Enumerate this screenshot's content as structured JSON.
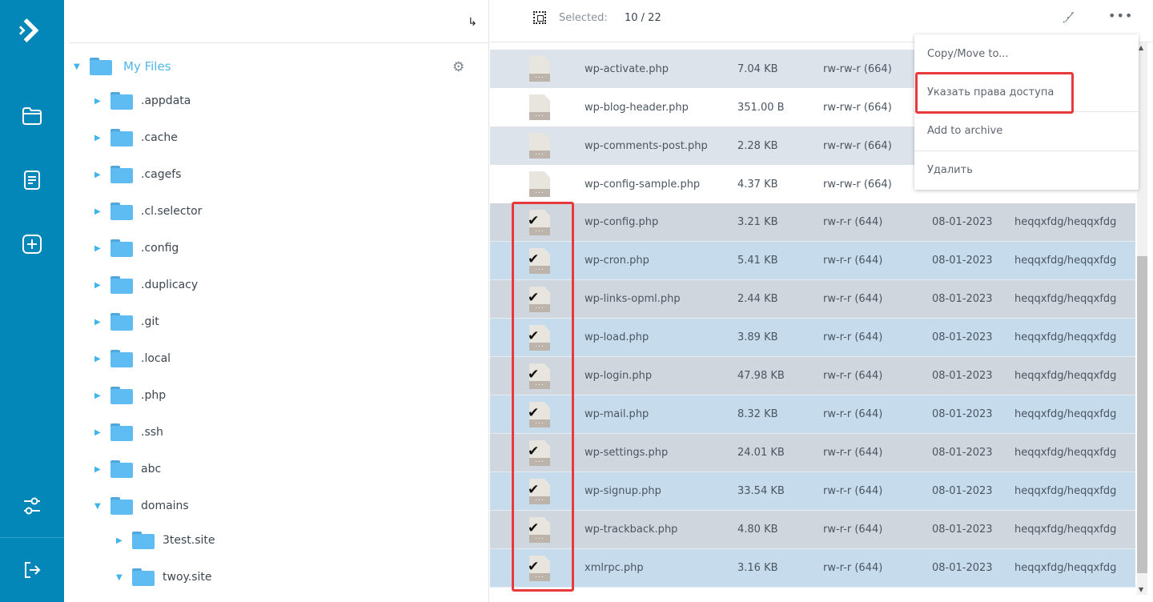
{
  "rail": {
    "icons": [
      "logo-icon",
      "folder-icon",
      "document-icon",
      "add-icon",
      "settings-sliders-icon",
      "logout-icon"
    ]
  },
  "tree": {
    "root": "My Files",
    "items": [
      {
        "label": ".appdata",
        "expanded": false
      },
      {
        "label": ".cache",
        "expanded": false
      },
      {
        "label": ".cagefs",
        "expanded": false
      },
      {
        "label": ".cl.selector",
        "expanded": false
      },
      {
        "label": ".config",
        "expanded": false
      },
      {
        "label": ".duplicacy",
        "expanded": false
      },
      {
        "label": ".git",
        "expanded": false
      },
      {
        "label": ".local",
        "expanded": false
      },
      {
        "label": ".php",
        "expanded": false
      },
      {
        "label": ".ssh",
        "expanded": false
      },
      {
        "label": "abc",
        "expanded": false
      },
      {
        "label": "domains",
        "expanded": true
      }
    ],
    "sub": [
      {
        "label": "3test.site",
        "expanded": false
      },
      {
        "label": "twoy.site",
        "expanded": true
      }
    ]
  },
  "header": {
    "selected_label": "Selected:",
    "selected_value": "10 / 22"
  },
  "files": [
    {
      "name": "wp-activate.php",
      "size": "7.04 KB",
      "perms": "rw-rw-r (664)",
      "date": "",
      "owner": "",
      "checked": false
    },
    {
      "name": "wp-blog-header.php",
      "size": "351.00 B",
      "perms": "rw-rw-r (664)",
      "date": "",
      "owner": "",
      "checked": false
    },
    {
      "name": "wp-comments-post.php",
      "size": "2.28 KB",
      "perms": "rw-rw-r (664)",
      "date": "",
      "owner": "",
      "checked": false
    },
    {
      "name": "wp-config-sample.php",
      "size": "4.37 KB",
      "perms": "rw-rw-r (664)",
      "date": "",
      "owner": "",
      "checked": false
    },
    {
      "name": "wp-config.php",
      "size": "3.21 KB",
      "perms": "rw-r-r (644)",
      "date": "08-01-2023",
      "owner": "heqqxfdg/heqqxfdg",
      "checked": true
    },
    {
      "name": "wp-cron.php",
      "size": "5.41 KB",
      "perms": "rw-r-r (644)",
      "date": "08-01-2023",
      "owner": "heqqxfdg/heqqxfdg",
      "checked": true
    },
    {
      "name": "wp-links-opml.php",
      "size": "2.44 KB",
      "perms": "rw-r-r (644)",
      "date": "08-01-2023",
      "owner": "heqqxfdg/heqqxfdg",
      "checked": true
    },
    {
      "name": "wp-load.php",
      "size": "3.89 KB",
      "perms": "rw-r-r (644)",
      "date": "08-01-2023",
      "owner": "heqqxfdg/heqqxfdg",
      "checked": true
    },
    {
      "name": "wp-login.php",
      "size": "47.98 KB",
      "perms": "rw-r-r (644)",
      "date": "08-01-2023",
      "owner": "heqqxfdg/heqqxfdg",
      "checked": true
    },
    {
      "name": "wp-mail.php",
      "size": "8.32 KB",
      "perms": "rw-r-r (644)",
      "date": "08-01-2023",
      "owner": "heqqxfdg/heqqxfdg",
      "checked": true
    },
    {
      "name": "wp-settings.php",
      "size": "24.01 KB",
      "perms": "rw-r-r (644)",
      "date": "08-01-2023",
      "owner": "heqqxfdg/heqqxfdg",
      "checked": true
    },
    {
      "name": "wp-signup.php",
      "size": "33.54 KB",
      "perms": "rw-r-r (644)",
      "date": "08-01-2023",
      "owner": "heqqxfdg/heqqxfdg",
      "checked": true
    },
    {
      "name": "wp-trackback.php",
      "size": "4.80 KB",
      "perms": "rw-r-r (644)",
      "date": "08-01-2023",
      "owner": "heqqxfdg/heqqxfdg",
      "checked": true
    },
    {
      "name": "xmlrpc.php",
      "size": "3.16 KB",
      "perms": "rw-r-r (644)",
      "date": "08-01-2023",
      "owner": "heqqxfdg/heqqxfdg",
      "checked": true
    }
  ],
  "menu": {
    "items": [
      "Copy/Move to...",
      "Указать права доступа",
      "Add to archive",
      "Удалить"
    ],
    "highlighted": "Указать права доступа"
  },
  "colors": {
    "rail": "#0386b8",
    "accent": "#4fb7ec",
    "highlight": "#e8393d",
    "checked_a": "#d0d6de",
    "checked_b": "#c6dcec",
    "stripe": "#dde3eb"
  }
}
